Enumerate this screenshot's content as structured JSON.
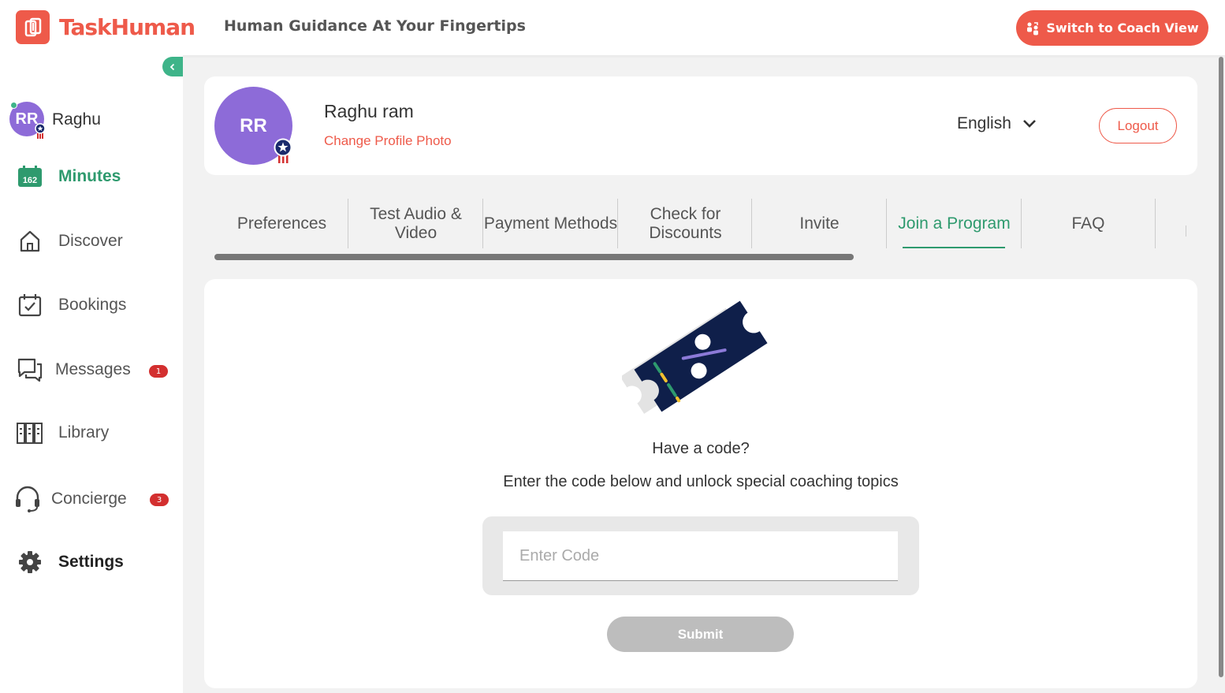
{
  "header": {
    "brand": "TaskHuman",
    "tagline": "Human Guidance At Your Fingertips",
    "coach_button": "Switch to Coach View"
  },
  "sidebar": {
    "user": {
      "initials": "RR",
      "name": "Raghu"
    },
    "minutes": {
      "count": "162",
      "label": "Minutes"
    },
    "items": [
      {
        "label": "Discover",
        "icon": "home-icon"
      },
      {
        "label": "Bookings",
        "icon": "calendar-check-icon"
      },
      {
        "label": "Messages",
        "icon": "chat-icon",
        "badge": "1"
      },
      {
        "label": "Library",
        "icon": "library-icon"
      },
      {
        "label": "Concierge",
        "icon": "headset-icon",
        "badge": "3"
      },
      {
        "label": "Settings",
        "icon": "gear-icon"
      }
    ]
  },
  "profile": {
    "initials": "RR",
    "name": "Raghu ram",
    "change_photo": "Change Profile Photo",
    "language": "English",
    "logout": "Logout"
  },
  "tabs": [
    {
      "label": "Preferences"
    },
    {
      "label": "Test Audio & Video"
    },
    {
      "label": "Payment Methods"
    },
    {
      "label": "Check for Discounts"
    },
    {
      "label": "Invite"
    },
    {
      "label": "Join a Program",
      "active": true
    },
    {
      "label": "FAQ"
    }
  ],
  "join_program": {
    "heading": "Have a code?",
    "description": "Enter the code below and unlock special coaching topics",
    "input_placeholder": "Enter Code",
    "input_value": "",
    "submit": "Submit"
  },
  "colors": {
    "brand": "#ee5a4a",
    "accent_green": "#2e9a6e",
    "avatar": "#8d6bd8",
    "badge": "#d32f2f",
    "submit_disabled": "#bdbdbd"
  }
}
